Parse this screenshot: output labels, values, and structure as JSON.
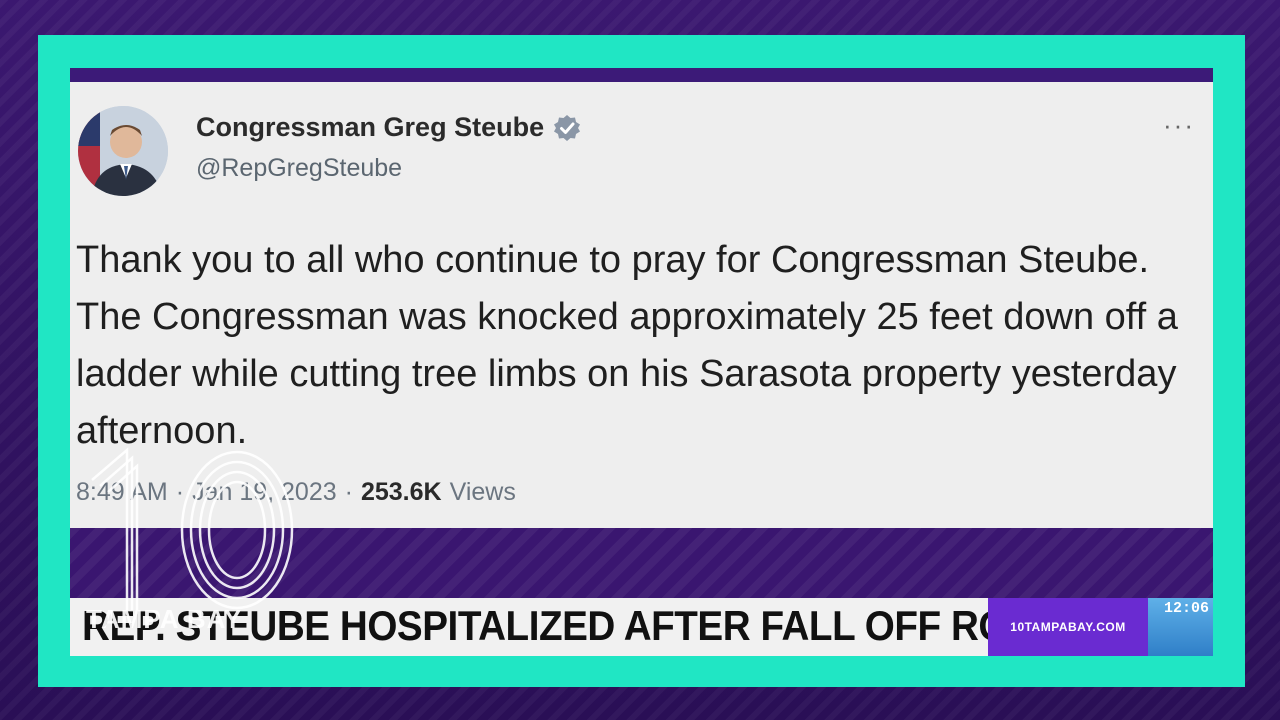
{
  "tweet": {
    "author_name": "Congressman Greg Steube",
    "handle": "@RepGregSteube",
    "more_label": "···",
    "text": "Thank you to all who continue to pray for Congressman Steube. The Congressman was knocked approximately 25 feet down off a ladder while cutting tree limbs on his Sarasota property yesterday afternoon.",
    "time": "8:49 AM",
    "separator": "·",
    "date": "Jan 19, 2023",
    "views_count": "253.6K",
    "views_label": "Views"
  },
  "lower_third": {
    "headline": "REP. STEUBE HOSPITALIZED AFTER FALL OFF ROOF",
    "site": "10TAMPABAY.COM",
    "clock": "12:06"
  },
  "station_logo": {
    "text": "TAMPA BAY"
  },
  "colors": {
    "frame": "#20e6c4",
    "background": "#3a1670",
    "verified": "#2e8bd6",
    "site_box": "#6a2bd1"
  }
}
